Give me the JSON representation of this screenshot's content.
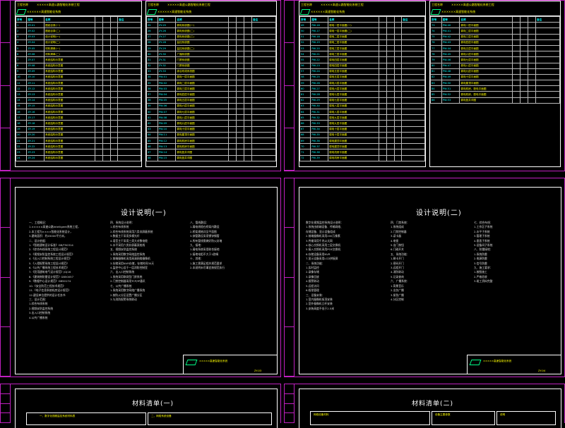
{
  "sheets": {
    "drawing_list_a": {
      "table1": {
        "project": "工程名称",
        "project_name": "×××××高速公路智能化系统工程",
        "subtitle": "××××××高速智能化系统",
        "cols": [
          "序号",
          "图号",
          "名称",
          "",
          "",
          "",
          "备注"
        ],
        "rows": [
          [
            "1",
            "ZY-01",
            "图纸目录(一)"
          ],
          [
            "2",
            "ZY-02",
            "图纸目录(二)"
          ],
          [
            "3",
            "ZY-03",
            "设计说明(一)"
          ],
          [
            "4",
            "ZY-04",
            "设计说明(二)"
          ],
          [
            "5",
            "ZY-05",
            "材料清单(一)"
          ],
          [
            "6",
            "ZY-06",
            "材料清单(二)"
          ],
          [
            "7",
            "ZY-07",
            "系统结构示意图"
          ],
          [
            "8",
            "ZY-08",
            "系统结构示意图"
          ],
          [
            "9",
            "ZY-09",
            "系统结构示意图"
          ],
          [
            "10",
            "ZY-10",
            "系统结构示意图"
          ],
          [
            "11",
            "ZY-11",
            "系统结构示意图"
          ],
          [
            "12",
            "ZY-12",
            "系统结构示意图"
          ],
          [
            "13",
            "ZY-13",
            "系统结构示意图"
          ],
          [
            "14",
            "ZY-14",
            "系统结构示意图"
          ],
          [
            "15",
            "ZY-15",
            "系统结构示意图"
          ],
          [
            "16",
            "ZY-16",
            "系统结构示意图"
          ],
          [
            "17",
            "ZY-17",
            "系统结构示意图"
          ],
          [
            "18",
            "ZY-18",
            "系统结构示意图"
          ],
          [
            "19",
            "ZY-19",
            "系统结构示意图"
          ],
          [
            "20",
            "ZY-20",
            "系统结构示意图"
          ],
          [
            "21",
            "ZY-21",
            "系统结构示意图"
          ],
          [
            "22",
            "ZY-22",
            "系统结构示意图"
          ],
          [
            "23",
            "ZY-23",
            "系统结构示意图"
          ],
          [
            "24",
            "ZY-24",
            "系统结构示意图"
          ]
        ]
      },
      "table2": {
        "project": "工程名称",
        "project_name": "×××××高速公路智能化系统工程",
        "subtitle": "××××××高速智能化系统",
        "cols": [
          "序号",
          "图号",
          "名称",
          "",
          "",
          "",
          "备注"
        ],
        "rows": [
          [
            "25",
            "ZY-25",
            "弱电系统图(一)"
          ],
          [
            "26",
            "ZY-26",
            "弱电系统图(二)"
          ],
          [
            "27",
            "ZY-27",
            "弱电系统图(三)"
          ],
          [
            "28",
            "ZY-28",
            "监控系统图"
          ],
          [
            "29",
            "ZY-29",
            "监控系统图(二)"
          ],
          [
            "30",
            "ZY-30",
            "广播系统图"
          ],
          [
            "31",
            "ZY-31",
            "门禁系统图"
          ],
          [
            "32",
            "ZY-32",
            "门禁系统图"
          ],
          [
            "33",
            "ZY-33",
            "综合布线系统图"
          ],
          [
            "34",
            "PW-01",
            "弱电一层平面图"
          ],
          [
            "35",
            "PW-02",
            "弱电二层平面图"
          ],
          [
            "36",
            "PW-03",
            "弱电三层平面图"
          ],
          [
            "37",
            "PW-04",
            "弱电四层平面图"
          ],
          [
            "38",
            "PW-05",
            "弱电五层平面图"
          ],
          [
            "39",
            "PW-06",
            "弱电六层平面图"
          ],
          [
            "40",
            "PW-07",
            "弱电七层平面图"
          ],
          [
            "41",
            "PW-08",
            "弱电八层平面图"
          ],
          [
            "42",
            "PW-09",
            "弱电九层平面图"
          ],
          [
            "43",
            "PW-10",
            "弱电十层平面图"
          ],
          [
            "44",
            "PW-11",
            "弱电屋顶平面图"
          ],
          [
            "45",
            "PW-12",
            "弱电机房平面图"
          ],
          [
            "46",
            "PW-13",
            "弱电机房平面图"
          ],
          [
            "47",
            "PW-14",
            "弱电竖井详图"
          ],
          [
            "48",
            "PW-15",
            "弱电竖井详图"
          ]
        ]
      }
    },
    "drawing_list_b": {
      "table1": {
        "project": "工程名称",
        "project_name": "×××××高速公路智能化系统工程",
        "subtitle": "××××××高速智能化系统",
        "cols": [
          "序号",
          "图号",
          "名称",
          "",
          "",
          "",
          "备注"
        ],
        "rows": [
          [
            "49",
            "PW-16",
            "弱电一层平面图(一)"
          ],
          [
            "50",
            "PW-17",
            "弱电一层平面图(二)"
          ],
          [
            "51",
            "PW-18",
            "弱电二层平面图"
          ],
          [
            "52",
            "PW-19",
            "弱电二层平面图"
          ],
          [
            "53",
            "PW-20",
            "弱电三层平面图"
          ],
          [
            "54",
            "PW-21",
            "弱电三层平面图"
          ],
          [
            "55",
            "PW-22",
            "弱电四层平面图"
          ],
          [
            "56",
            "PW-23",
            "弱电四层平面图"
          ],
          [
            "57",
            "PW-24",
            "弱电五层平面图"
          ],
          [
            "58",
            "PW-25",
            "弱电五层平面图"
          ],
          [
            "59",
            "PW-26",
            "弱电六层平面图"
          ],
          [
            "60",
            "PW-27",
            "弱电六层平面图"
          ],
          [
            "61",
            "PW-28",
            "弱电七层平面图"
          ],
          [
            "62",
            "PW-29",
            "弱电七层平面图"
          ],
          [
            "63",
            "PW-30",
            "弱电八层平面图"
          ],
          [
            "64",
            "PW-31",
            "弱电八层平面图"
          ],
          [
            "65",
            "PW-32",
            "弱电九层平面图"
          ],
          [
            "66",
            "PW-33",
            "弱电九层平面图"
          ],
          [
            "67",
            "PW-34",
            "弱电十层平面图"
          ],
          [
            "68",
            "PW-35",
            "弱电十层平面图"
          ],
          [
            "69",
            "PW-36",
            "弱电屋顶平面图"
          ],
          [
            "70",
            "PW-37",
            "弱电屋顶平面图"
          ],
          [
            "71",
            "PW-38",
            "弱电机房平面图"
          ],
          [
            "72",
            "PW-39",
            "弱电机房平面图"
          ]
        ]
      },
      "table2": {
        "project": "工程名称",
        "project_name": "×××××高速公路智能化系统工程",
        "subtitle": "××××××高速智能化系统",
        "cols": [
          "序号",
          "图号",
          "名称",
          "",
          "",
          "",
          "备注"
        ],
        "rows": [
          [
            "73",
            "PW-40",
            "弱电一层平面图"
          ],
          [
            "74",
            "PW-41",
            "弱电二层平面图"
          ],
          [
            "75",
            "PW-42",
            "弱电三层平面图"
          ],
          [
            "76",
            "PW-43",
            "弱电四层平面图"
          ],
          [
            "77",
            "PW-44",
            "弱电五层平面图"
          ],
          [
            "78",
            "PW-45",
            "弱电六层平面图"
          ],
          [
            "79",
            "PW-46",
            "弱电七层平面图"
          ],
          [
            "80",
            "PW-47",
            "弱电八层平面图"
          ],
          [
            "81",
            "PW-48",
            "弱电九层平面图"
          ],
          [
            "82",
            "PW-49",
            "弱电十层平面图"
          ],
          [
            "83",
            "PW-50",
            "弱电屋顶平面图"
          ],
          [
            "84",
            "PW-51",
            "弱电机房、配电平面图"
          ],
          [
            "85",
            "PW-52",
            "弱电机房、配电平面图"
          ],
          [
            "86",
            "PW-53",
            "弱电竖井详图"
          ]
        ]
      }
    },
    "design_a": {
      "title": "设计说明(一)",
      "col1": [
        "一、工程概况：",
        "1.×××××高速公路Intelligent系统工程，",
        "2.本工程为××××智能化系统设计，",
        "3.建筑面积：约45000平方米，",
        "二、设计依据：",
        "1.《智能建筑设计标准》GB/T50314",
        "2.《综合布线系统工程设计规范》",
        "3.《视频安防监控系统工程设计规范》",
        "4.《出入口控制系统工程设计规范》",
        "5.《入侵报警系统工程设计规范》",
        "6.《公共广播系统工程技术规范》",
        "7.《民用建筑电气设计规范》JGJ16",
        "8.《建筑物防雷设计规范》GB50057",
        "9.《数据中心设计规范》GB50174",
        "10.《安全防范工程技术规范》",
        "11.《电子信息系统机房设计规范》",
        "12.建设单位提供的设计任务书",
        "三、设计范围：",
        "1.综合布线系统",
        "2.视频安防监控系统",
        "3.出入口控制系统",
        "4.公共广播系统"
      ],
      "col2": [
        "四、系统设计说明：",
        "1.综合布线系统",
        "2.综合布线系统采用六类非屏蔽系统",
        "3.数据主干采用多模光纤",
        "4.语音主干采用三类大对数电缆",
        "5.水平采用六类非屏蔽双绞线",
        "五、视频安防监控系统",
        "1.系统采用数字网络监控系统",
        "2.前端摄像机采用高清网络摄像机",
        "3.存储采用NVR存储，存储时间30天",
        "4.监控中心设于一层消防控制室",
        "六、出入口控制系统",
        "1.系统采用联网型门禁系统",
        "2.门禁控制器采用TCP/IP通讯",
        "七、公共广播系统",
        "1.系统采用数字网络广播系统",
        "2.按防火分区设置广播分区",
        "3.与消防报警系统联动"
      ],
      "col3": [
        "八、管线敷设：",
        "1.弱电线缆在桥架内敷设",
        "2.桥架规格详见平面图",
        "3.穿管敷设采用镀锌钢管",
        "4.所有管线需做好防火封堵",
        "九、接地：",
        "1.弱电系统采用联合接地",
        "2.接地电阻不大于1欧姆",
        "十、其他：",
        "1.施工需满足相关规范要求",
        "2.本说明未尽事宜按规范执行"
      ],
      "titleblock": "×××××高速智能化系统",
      "sheet_no": "ZY-03"
    },
    "design_b": {
      "title": "设计说明(二)",
      "col1": [
        "数字化视频监控系统设计说明：",
        "1.系统由前端设备、传输网络、",
        "存储设备、显示设备组成",
        "2.前端摄像机采用200万像素",
        "3.传输采用千兆以太网",
        "4.核心交换机采用三层交换机",
        "5.接入交换机采用POE交换机",
        "6.存储设备采用NVR",
        "7.显示设备采用LCD拼接屏",
        "二、系统功能：",
        "1.实时监控",
        "2.录像存储",
        "3.录像回放",
        "4.报警联动",
        "5.远程访问",
        "6.权限管理",
        "三、设备安装：",
        "1.室内摄像机吸顶安装",
        "2.室外摄像机立杆安装",
        "3.安装高度不低于2.5米"
      ],
      "col2": [
        "四、门禁系统：",
        "1.系统组成",
        "2.门禁控制器",
        "3.读卡器",
        "4.电锁",
        "5.出门按钮",
        "6.门磁开关",
        "五、系统功能：",
        "1.刷卡开门",
        "2.密码开门",
        "3.远程开门",
        "4.消防联动",
        "5.记录查询",
        "六、广播系统：",
        "1.背景音乐",
        "2.业务广播",
        "3.紧急广播",
        "4.分区控制"
      ],
      "col3": [
        "七、综合布线：",
        "1.工作区子系统",
        "2.水平子系统",
        "3.管理子系统",
        "4.垂直子系统",
        "5.设备间子系统",
        "八、防雷接地：",
        "1.系统防雷",
        "2.电源防雷",
        "3.信号防雷",
        "九、施工要求：",
        "1.按图施工",
        "2.严格验收",
        "3.竣工资料完整"
      ],
      "titleblock": "×××××高速智能化系统",
      "sheet_no": "ZY-04"
    },
    "material_a": {
      "title": "材料清单(一)",
      "header1": "一、数字化视频监控系统材料表",
      "header2": "二、网络系统设备"
    },
    "material_b": {
      "title": "材料清单(二)",
      "header1": "网络设备材料",
      "header2": "设备主要参数",
      "header3": "说明"
    }
  },
  "colors": {
    "frame": "#c020c0",
    "text_cyan": "#00ffff",
    "text_yellow": "#ffff00",
    "logo": "#00ff88"
  }
}
